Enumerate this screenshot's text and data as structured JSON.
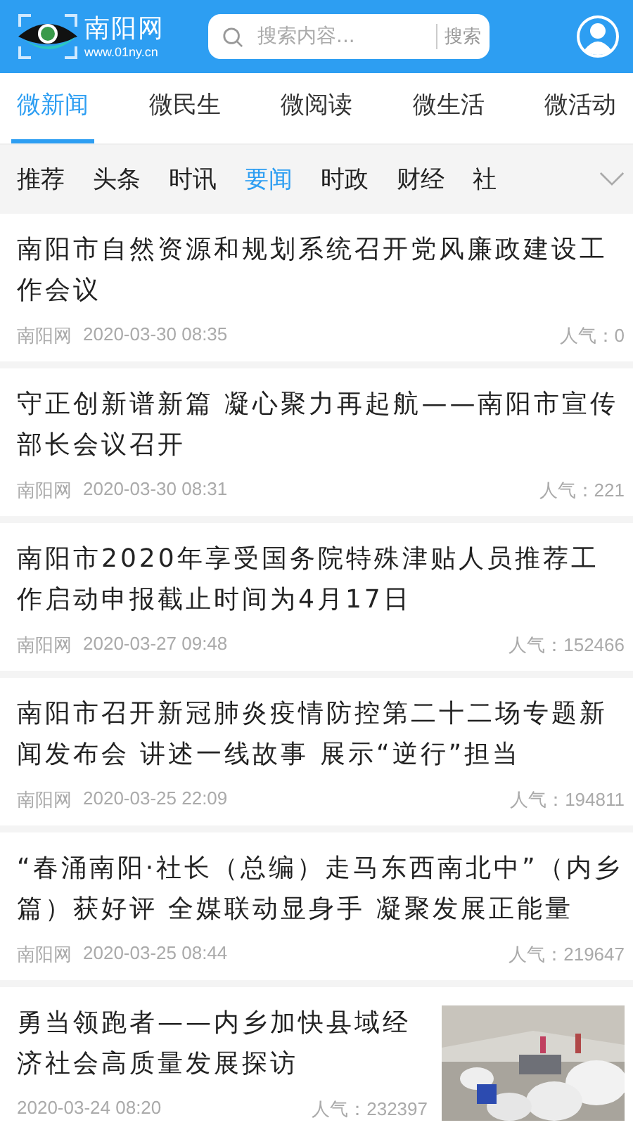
{
  "header": {
    "logo_title": "南阳网",
    "logo_url": "www.01ny.cn",
    "search": {
      "placeholder": "搜索内容...",
      "button": "搜索"
    }
  },
  "tabs": [
    {
      "label": "微新闻",
      "selected": true
    },
    {
      "label": "微民生",
      "selected": false
    },
    {
      "label": "微阅读",
      "selected": false
    },
    {
      "label": "微生活",
      "selected": false
    },
    {
      "label": "微活动",
      "selected": false
    }
  ],
  "categories": [
    {
      "label": "推荐",
      "selected": false
    },
    {
      "label": "头条",
      "selected": false
    },
    {
      "label": "时讯",
      "selected": false
    },
    {
      "label": "要闻",
      "selected": true
    },
    {
      "label": "时政",
      "selected": false
    },
    {
      "label": "财经",
      "selected": false
    },
    {
      "label": "社",
      "selected": false
    }
  ],
  "articles": [
    {
      "title": "南阳市自然资源和规划系统召开党风廉政建设工作会议",
      "source": "南阳网",
      "date": "2020-03-30 08:35",
      "popularity": "人气：0"
    },
    {
      "title": "守正创新谱新篇 凝心聚力再起航——南阳市宣传部长会议召开",
      "source": "南阳网",
      "date": "2020-03-30 08:31",
      "popularity": "人气：221"
    },
    {
      "title": "南阳市2020年享受国务院特殊津贴人员推荐工作启动申报截止时间为4月17日",
      "source": "南阳网",
      "date": "2020-03-27 09:48",
      "popularity": "人气：152466"
    },
    {
      "title": "南阳市召开新冠肺炎疫情防控第二十二场专题新闻发布会 讲述一线故事 展示“逆行”担当",
      "source": "南阳网",
      "date": "2020-03-25 22:09",
      "popularity": "人气：194811"
    },
    {
      "title": "“春涌南阳·社长（总编）走马东西南北中”（内乡篇）获好评 全媒联动显身手 凝聚发展正能量",
      "source": "南阳网",
      "date": "2020-03-25 08:44",
      "popularity": "人气：219647"
    },
    {
      "title": "勇当领跑者——内乡加快县域经济社会高质量发展探访",
      "date": "2020-03-24 08:20",
      "popularity": "人气：232397"
    }
  ]
}
